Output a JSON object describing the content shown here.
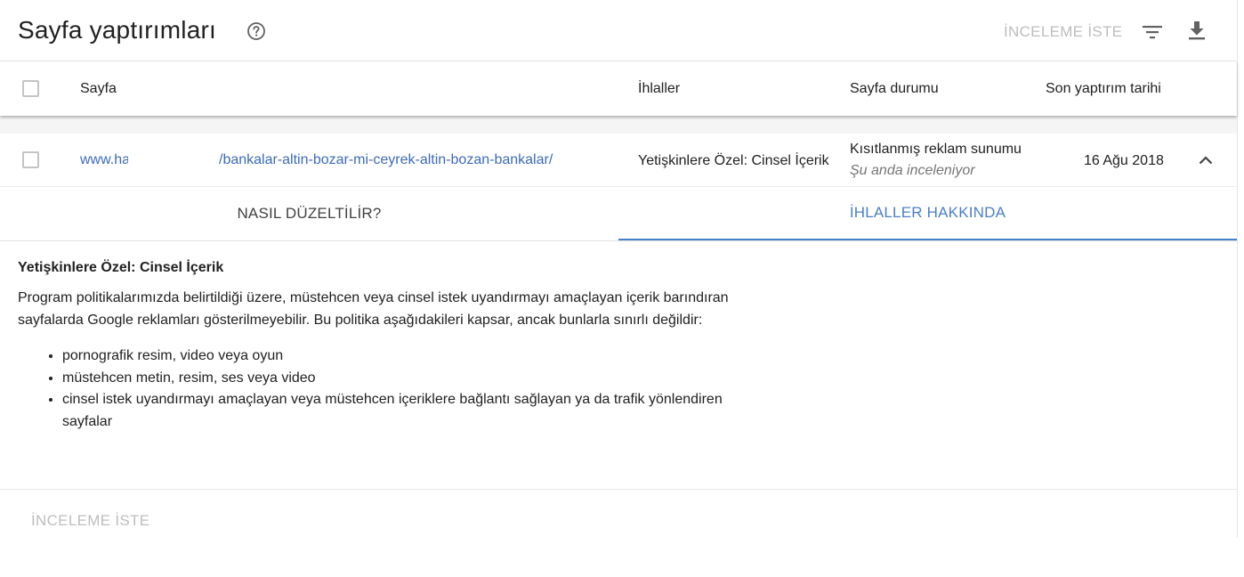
{
  "header": {
    "title": "Sayfa yaptırımları",
    "help_icon": "help-circle-icon",
    "review_button": "İNCELEME İSTE",
    "filter_icon": "filter-icon",
    "download_icon": "download-icon"
  },
  "table": {
    "columns": {
      "page": "Sayfa",
      "violations": "İhlaller",
      "status": "Sayfa durumu",
      "date": "Son yaptırım tarihi"
    },
    "rows": [
      {
        "url_host": "www.ha",
        "url_path": "/bankalar-altin-bozar-mi-ceyrek-altin-bozan-bankalar/",
        "violation": "Yetişkinlere Özel: Cinsel İçerik",
        "status": "Kısıtlanmış reklam sunumu",
        "status_detail": "Şu anda inceleniyor",
        "date": "16 Ağu 2018",
        "expanded": true
      }
    ]
  },
  "tabs": {
    "fix": "NASIL DÜZELTİLİR?",
    "about": "İHLALLER HAKKINDA",
    "active": "about"
  },
  "details": {
    "title": "Yetişkinlere Özel: Cinsel İçerik",
    "body": "Program politikalarımızda belirtildiği üzere, müstehcen veya cinsel istek uyandırmayı amaçlayan içerik barındıran sayfalarda Google reklamları gösterilmeyebilir. Bu politika aşağıdakileri kapsar, ancak bunlarla sınırlı değildir:",
    "items": [
      "pornografik resim, video veya oyun",
      "müstehcen metin, resim, ses veya video",
      "cinsel istek uyandırmayı amaçlayan veya müstehcen içeriklere bağlantı sağlayan ya da trafik yönlendiren sayfalar"
    ]
  },
  "footer": {
    "review_button": "İNCELEME İSTE"
  },
  "colors": {
    "link": "#3b6bb5",
    "accent": "#4a7fc9",
    "disabled": "#bdbdbd"
  }
}
